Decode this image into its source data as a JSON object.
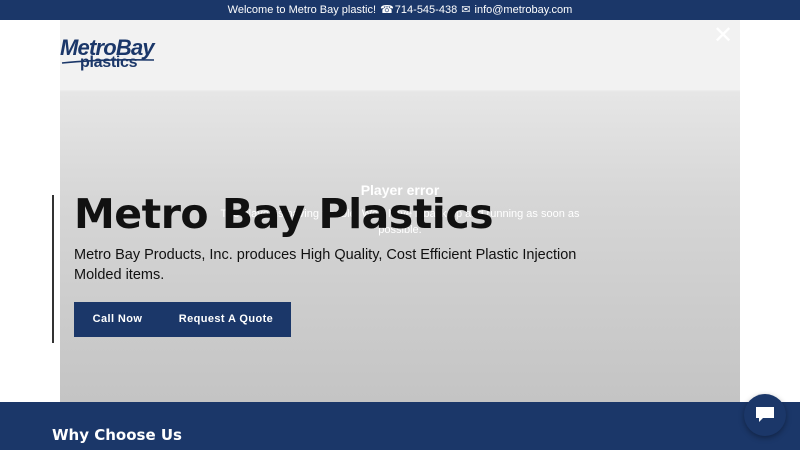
{
  "topbar": {
    "welcome": "Welcome to Metro Bay plastic!",
    "phone_icon": "telephone-icon",
    "phone": "714-545-438",
    "mail_icon": "envelope-icon",
    "email": "info@metrobay.com"
  },
  "logo": {
    "line1": "MetroBay",
    "line2": "plastics"
  },
  "modal": {
    "close_icon": "close-icon",
    "player_error_title": "Player error",
    "player_error_message": "The player is having trouble. We'll have it back up and running as soon as possible."
  },
  "hero": {
    "title": "Metro Bay Plastics",
    "subtitle": "Metro Bay Products, Inc. produces High Quality, Cost Efficient Plastic Injection Molded items.",
    "call_button": "Call Now",
    "quote_button": "Request A Quote"
  },
  "section": {
    "why_title": "Why Choose Us"
  },
  "chat": {
    "icon": "chat-bubble-icon"
  },
  "colors": {
    "brand_navy": "#1b3769",
    "modal_gray": "#d0d0d0",
    "text_dark": "#111111"
  }
}
